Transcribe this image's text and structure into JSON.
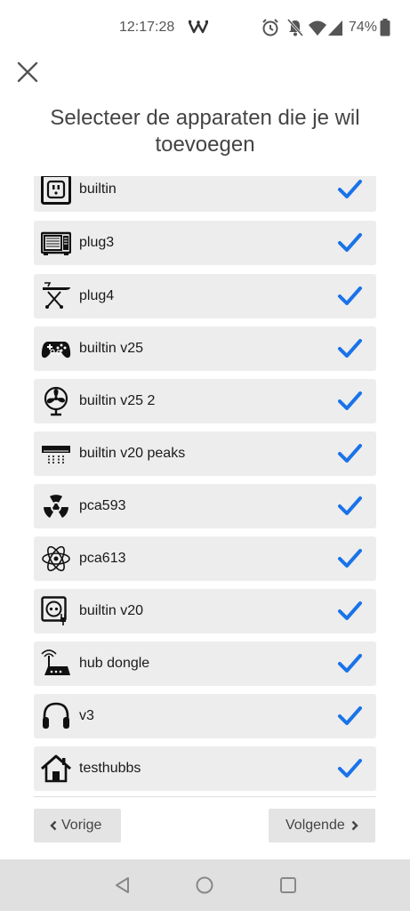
{
  "status": {
    "time": "12:17:28",
    "battery": "74%"
  },
  "page": {
    "title": "Selecteer de apparaten die je wil toevoegen"
  },
  "devices": [
    {
      "label": "builtin",
      "icon": "wall-socket-icon",
      "checked": true
    },
    {
      "label": "plug3",
      "icon": "microwave-icon",
      "checked": true
    },
    {
      "label": "plug4",
      "icon": "ironing-board-icon",
      "checked": true
    },
    {
      "label": "builtin v25",
      "icon": "gamepad-icon",
      "checked": true
    },
    {
      "label": "builtin v25 2",
      "icon": "fan-icon",
      "checked": true
    },
    {
      "label": "builtin v20 peaks",
      "icon": "air-conditioner-icon",
      "checked": true
    },
    {
      "label": "pca593",
      "icon": "radiation-icon",
      "checked": true
    },
    {
      "label": "pca613",
      "icon": "atom-icon",
      "checked": true
    },
    {
      "label": "builtin v20",
      "icon": "power-socket-plug-icon",
      "checked": true
    },
    {
      "label": "hub dongle",
      "icon": "router-icon",
      "checked": true
    },
    {
      "label": "v3",
      "icon": "headphones-icon",
      "checked": true
    },
    {
      "label": "testhubbs",
      "icon": "home-icon",
      "checked": true
    }
  ],
  "navigation": {
    "previous_label": "Vorige",
    "next_label": "Volgende"
  },
  "colors": {
    "accent": "#1a73e8",
    "item_background": "#ededed",
    "button_background": "#e4e4e4",
    "system_nav_background": "#e0e0e0"
  }
}
